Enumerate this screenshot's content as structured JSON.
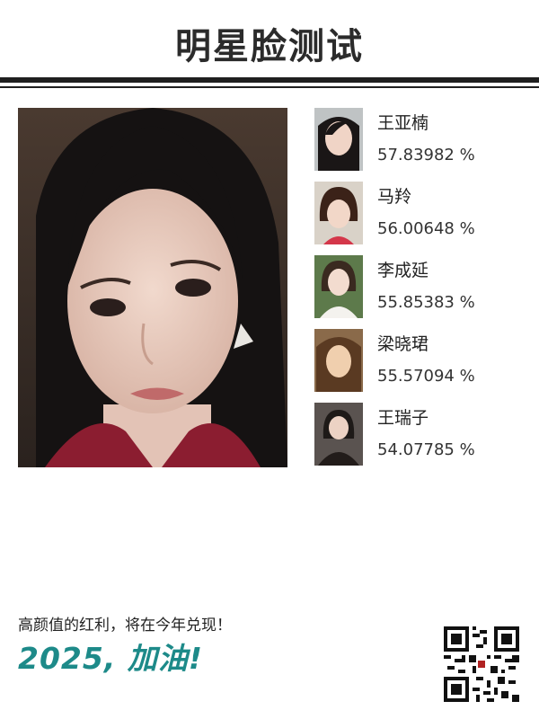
{
  "header": {
    "title": "明星脸测试"
  },
  "results": [
    {
      "name": "王亚楠",
      "score": "57.83982 %"
    },
    {
      "name": "马羚",
      "score": "56.00648 %"
    },
    {
      "name": "李成延",
      "score": "55.85383 %"
    },
    {
      "name": "梁晓珺",
      "score": "55.57094 %"
    },
    {
      "name": "王瑞子",
      "score": "54.07785 %"
    }
  ],
  "footer": {
    "line": "高颜值的红利，将在今年兑现！",
    "slogan": "2025, 加油!"
  },
  "colors": {
    "accent": "#1d8a89",
    "rule": "#1f1f1f"
  },
  "icons": {
    "qr": "qr-code-icon"
  }
}
